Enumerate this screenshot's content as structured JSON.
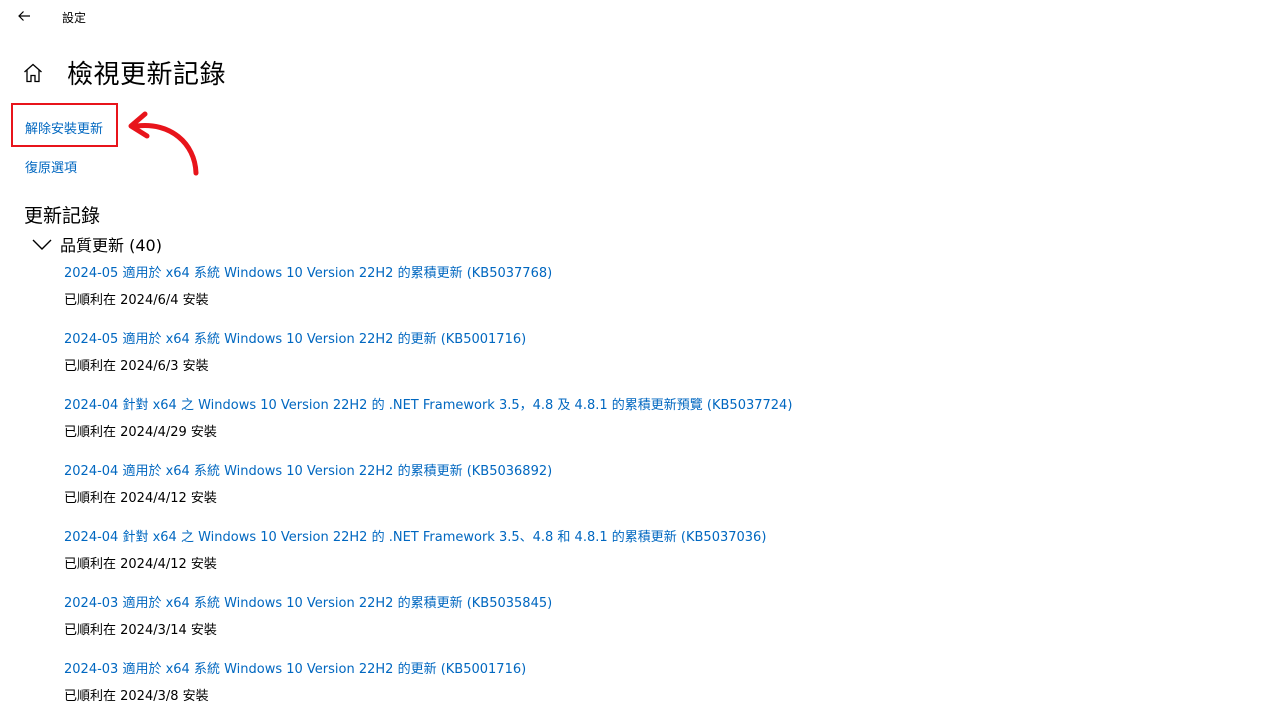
{
  "window": {
    "app_title": "設定"
  },
  "header": {
    "page_title": "檢視更新記錄"
  },
  "links": {
    "uninstall": "解除安裝更新",
    "recovery": "復原選項"
  },
  "history": {
    "section_title": "更新記錄",
    "category_label": "品質更新 (40)",
    "items": [
      {
        "title": "2024-05 適用於 x64 系統 Windows 10 Version 22H2 的累積更新 (KB5037768)",
        "status": "已順利在 2024/6/4 安裝"
      },
      {
        "title": "2024-05 適用於 x64 系統 Windows 10 Version 22H2 的更新 (KB5001716)",
        "status": "已順利在 2024/6/3 安裝"
      },
      {
        "title": "2024-04 針對 x64 之 Windows 10 Version 22H2 的 .NET Framework 3.5，4.8 及 4.8.1 的累積更新預覽 (KB5037724)",
        "status": "已順利在 2024/4/29 安裝"
      },
      {
        "title": "2024-04 適用於 x64 系統 Windows 10 Version 22H2 的累積更新 (KB5036892)",
        "status": "已順利在 2024/4/12 安裝"
      },
      {
        "title": "2024-04 針對 x64 之 Windows 10 Version 22H2 的 .NET Framework 3.5、4.8 和 4.8.1 的累積更新 (KB5037036)",
        "status": "已順利在 2024/4/12 安裝"
      },
      {
        "title": "2024-03 適用於 x64 系統 Windows 10 Version 22H2 的累積更新 (KB5035845)",
        "status": "已順利在 2024/3/14 安裝"
      },
      {
        "title": "2024-03 適用於 x64 系統 Windows 10 Version 22H2 的更新 (KB5001716)",
        "status": "已順利在 2024/3/8 安裝"
      }
    ]
  },
  "icons": {
    "back": "back-arrow-icon",
    "home": "home-icon",
    "expand": "chevron-down-icon"
  },
  "colors": {
    "link": "#0067c0",
    "highlight": "#e8141b"
  }
}
